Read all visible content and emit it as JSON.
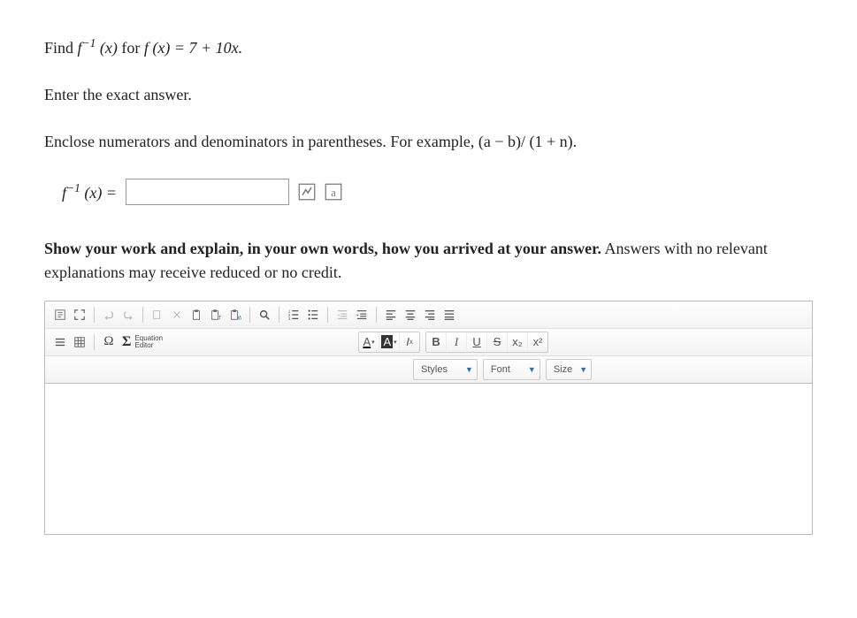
{
  "question": {
    "line1_prefix": "Find ",
    "line1_finv": "f",
    "line1_exp": "−1",
    "line1_paren": " (x)",
    "line1_mid": " for ",
    "line1_fx": "f (x) = 7 + 10x.",
    "line2": "Enter the exact answer.",
    "line3": "Enclose numerators and denominators in parentheses. For example, (a − b)/ (1 + n)."
  },
  "answer": {
    "label_f": "f",
    "label_exp": "−1",
    "label_paren": " (x) =",
    "value": ""
  },
  "work_prompt": {
    "bold": "Show your work and explain, in your own words, how you arrived at your answer.",
    "rest": " Answers with no relevant explanations may receive reduced or no credit."
  },
  "toolbar": {
    "equation_label1": "Equation",
    "equation_label2": "Editor",
    "styles": "Styles",
    "font": "Font",
    "size": "Size",
    "bold": "B",
    "italic": "I",
    "underline": "U",
    "strike": "S",
    "sub": "x₂",
    "supn": "x²",
    "Abtn": "A",
    "Abtn2": "A",
    "Ix": "I",
    "Ixsub": "x"
  }
}
